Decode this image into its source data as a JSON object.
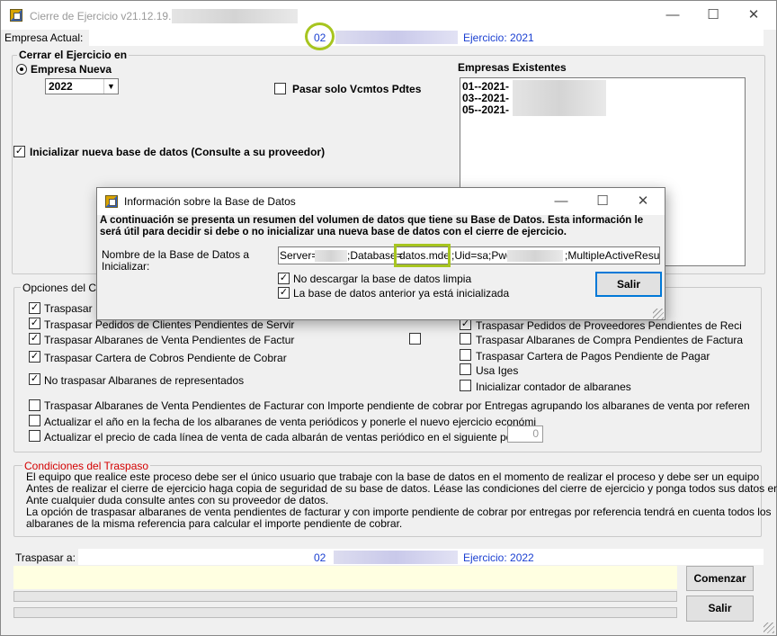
{
  "window": {
    "title": "Cierre de Ejercicio v21.12.19.1",
    "icon": "app-icon",
    "controls": {
      "minimize": "—",
      "maximize": "☐",
      "close": "✕"
    }
  },
  "header": {
    "empresa_label": "Empresa Actual:",
    "empresa_code": "02",
    "ejercicio": "Ejercicio: 2021"
  },
  "cerrar": {
    "legend": "Cerrar el Ejercicio en",
    "radio_label": "Empresa Nueva",
    "year": "2022",
    "pasar_label": "Pasar solo Vcmtos Pdtes",
    "inicializar_label": "Inicializar nueva base de datos (Consulte a su proveedor)"
  },
  "existentes": {
    "title": "Empresas Existentes",
    "items": [
      "01--2021-",
      "03--2021-",
      "05--2021-"
    ]
  },
  "opciones": {
    "legend": "Opciones del Cie",
    "left": [
      {
        "label": "Traspasar I",
        "checked": true
      },
      {
        "label": "Traspasar Pedidos de Clientes Pendientes de Servir",
        "checked": true
      },
      {
        "label": "Traspasar Albaranes de Venta Pendientes de Factur",
        "checked": true
      },
      {
        "label": "Traspasar Cartera de Cobros Pendiente de Cobrar",
        "checked": true
      },
      {
        "label": "No traspasar Albaranes de representados",
        "checked": true
      }
    ],
    "right": [
      {
        "label": "Traspasar Pedidos de Proveedores Pendientes de Reci",
        "checked": true
      },
      {
        "label": "Traspasar Albaranes de Compra Pendientes de Factura",
        "checked": false
      },
      {
        "label": "Traspasar Cartera de Pagos Pendiente de Pagar",
        "checked": false
      },
      {
        "label": "Usa Iges",
        "checked": false
      },
      {
        "label": "Inicializar contador de albaranes",
        "checked": false
      }
    ],
    "wide": [
      {
        "label": "Traspasar Albaranes de Venta Pendientes de Facturar con Importe pendiente de cobrar por Entregas agrupando los albaranes de venta por referen",
        "checked": false
      },
      {
        "label": "Actualizar el año en la fecha de los albaranes de venta periódicos y ponerle el nuevo ejercicio económi",
        "checked": false
      },
      {
        "label": "Actualizar el precio de cada línea de venta de cada albarán de ventas periódico en el siguiente porce",
        "checked": false
      }
    ],
    "porcentaje": "0"
  },
  "condiciones": {
    "title": "Condiciones del Traspaso",
    "lines": [
      "El equipo que realice este proceso debe ser el único usuario que trabaje con la base de datos en el momento de realizar el proceso y debe ser un equipo",
      "Antes de realizar el cierre de ejercicio haga copia de seguridad de su base de datos. Léase las condiciones del cierre de ejercicio y ponga todos sus datos en",
      "Ante cualquier duda consulte antes con su proveedor de datos.",
      "La opción de traspasar albaranes de venta pendientes de facturar y con importe pendiente de cobrar por entregas por referencia tendrá en cuenta todos los",
      "albaranes de la misma referencia para calcular el importe pendiente de cobrar."
    ]
  },
  "traspasar": {
    "label": "Traspasar a:",
    "code": "02",
    "ejercicio": "Ejercicio: 2022"
  },
  "buttons": {
    "comenzar": "Comenzar",
    "salir": "Salir"
  },
  "dialog": {
    "title": "Información sobre la Base de Datos",
    "intro_line1": "A continuación se presenta un resumen del volumen de datos que tiene su Base de Datos. Esta información le",
    "intro_line2": "será útil para decidir si debe o no inicializar una nueva base de datos con el cierre de ejercicio.",
    "nombre_label_1": "Nombre de la Base de Datos a",
    "nombre_label_2": "Inicializar:",
    "conn_server": "Server=",
    "conn_database": ";Database=",
    "conn_dbname": "datos.mde",
    "conn_uid": ";Uid=sa;Pwd=",
    "conn_rest": ";MultipleActiveResultSe",
    "chk1_label": "No descargar la base de datos limpia",
    "chk1_checked": true,
    "chk2_label": "La base de datos anterior ya está inicializada",
    "chk2_checked": true,
    "salir": "Salir"
  }
}
